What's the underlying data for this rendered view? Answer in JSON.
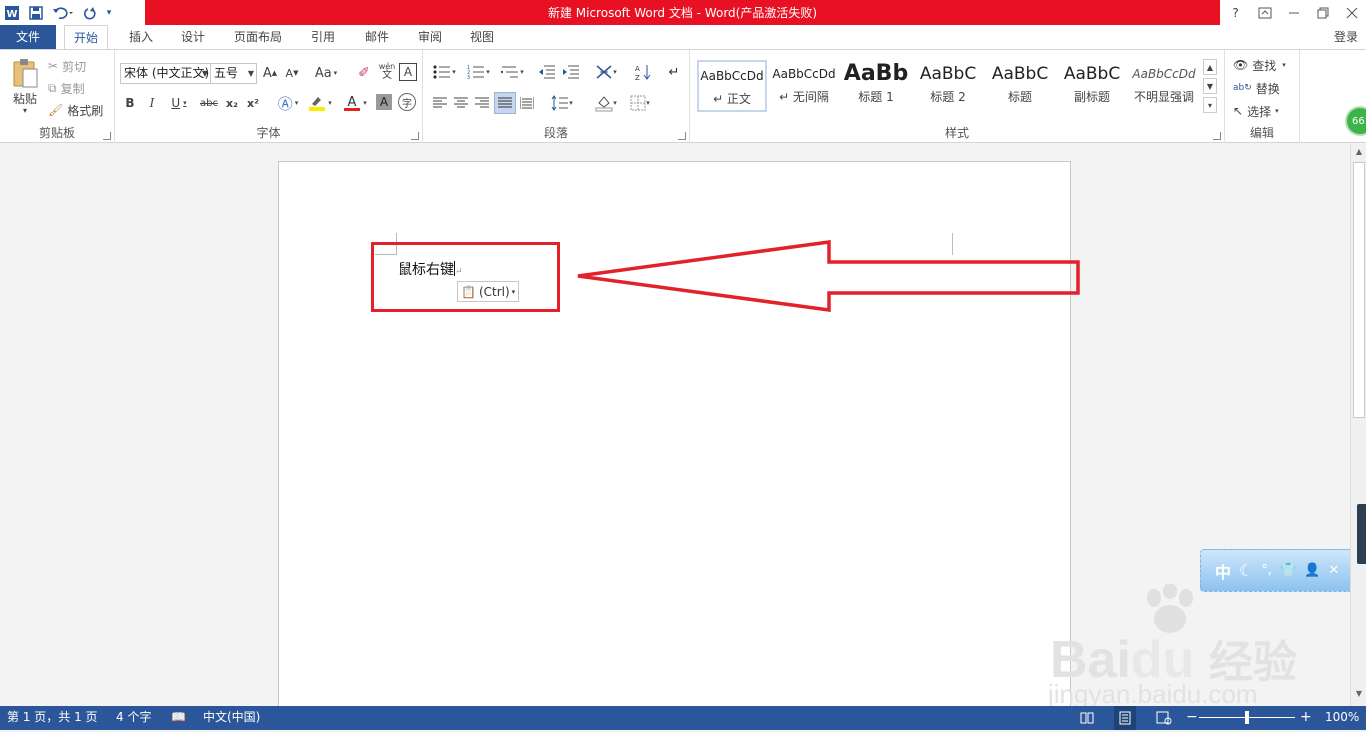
{
  "title_bar": {
    "title": "新建 Microsoft Word 文档 -  Word(产品激活失败)",
    "help": "?",
    "login": "登录"
  },
  "tabs": [
    "文件",
    "开始",
    "插入",
    "设计",
    "页面布局",
    "引用",
    "邮件",
    "审阅",
    "视图"
  ],
  "clipboard": {
    "paste": "粘贴",
    "cut": "剪切",
    "copy": "复制",
    "format_painter": "格式刷",
    "group_label": "剪贴板"
  },
  "font": {
    "font_name": "宋体 (中文正文)",
    "font_size": "五号",
    "change_case": "Aa",
    "bold": "B",
    "italic": "I",
    "underline": "U",
    "strikethrough": "abc",
    "subscript": "x₂",
    "superscript": "x²",
    "phonetic": "wén",
    "char_border": "A",
    "char_circle": "字",
    "group_label": "字体"
  },
  "paragraph": {
    "group_label": "段落"
  },
  "styles": {
    "items": [
      {
        "sample": "AaBbCcDd",
        "name": "↵ 正文"
      },
      {
        "sample": "AaBbCcDd",
        "name": "↵ 无间隔"
      },
      {
        "sample": "AaBb",
        "name": "标题 1"
      },
      {
        "sample": "AaBbC",
        "name": "标题 2"
      },
      {
        "sample": "AaBbC",
        "name": "标题"
      },
      {
        "sample": "AaBbC",
        "name": "副标题"
      },
      {
        "sample": "AaBbCcDd",
        "name": "不明显强调"
      }
    ],
    "group_label": "样式"
  },
  "editing": {
    "find": "查找",
    "replace": "替换",
    "select": "选择",
    "group_label": "编辑"
  },
  "document": {
    "text": "鼠标右键",
    "paste_options": "(Ctrl)"
  },
  "status": {
    "page": "第 1 页，共 1 页",
    "words": "4 个字",
    "language": "中文(中国)",
    "zoom": "100%",
    "zoom_level": 1.0
  },
  "overlays": {
    "badge": "66",
    "ime": "中",
    "watermark_url": "jingyan.baidu.com",
    "watermark_cn": "经验"
  },
  "colors": {
    "accent": "#2b579a",
    "title_red": "#e81123",
    "annotation_red": "#e3212b"
  }
}
